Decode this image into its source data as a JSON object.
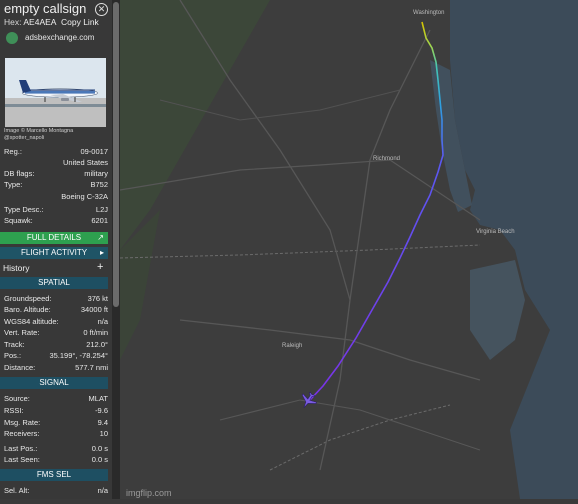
{
  "header": {
    "callsign": "empty callsign",
    "hex_label": "Hex:",
    "hex_value": "AE4AEA",
    "copy_link": "Copy Link",
    "close_icon": "close-icon",
    "site": "adsbexchange.com"
  },
  "photo": {
    "credit_line1": "Image © Marcello Montagna",
    "credit_line2": "@spotter_napoli"
  },
  "details": [
    {
      "k": "Reg.:",
      "v": "09-0017"
    },
    {
      "k": "",
      "v": "United States"
    },
    {
      "k": "DB flags:",
      "v": "military"
    },
    {
      "k": "Type:",
      "v": "B752"
    },
    {
      "k": "",
      "v": "Boeing C-32A"
    },
    {
      "k": "Type Desc.:",
      "v": "L2J"
    },
    {
      "k": "Squawk:",
      "v": "6201"
    }
  ],
  "buttons": {
    "full_details": "FULL DETAILS",
    "flight_activity": "FLIGHT ACTIVITY"
  },
  "history": "History",
  "sections": {
    "spatial": "SPATIAL",
    "signal": "SIGNAL",
    "fms": "FMS SEL"
  },
  "spatial": [
    {
      "k": "Groundspeed:",
      "v": "376 kt"
    },
    {
      "k": "Baro. Altitude:",
      "v": "34000 ft"
    },
    {
      "k": "WGS84 altitude:",
      "v": "n/a"
    },
    {
      "k": "Vert. Rate:",
      "v": "0 ft/min"
    },
    {
      "k": "Track:",
      "v": "212.0°"
    },
    {
      "k": "Pos.:",
      "v": "35.199°, -78.254°"
    },
    {
      "k": "Distance:",
      "v": "577.7 nmi"
    }
  ],
  "signal": [
    {
      "k": "Source:",
      "v": "MLAT"
    },
    {
      "k": "RSSI:",
      "v": "-9.6"
    },
    {
      "k": "Msg. Rate:",
      "v": "9.4"
    },
    {
      "k": "Receivers:",
      "v": "10"
    },
    {
      "k": "Last Pos.:",
      "v": "0.0 s"
    },
    {
      "k": "Last Seen:",
      "v": "0.0 s"
    }
  ],
  "fms_row": {
    "k": "Sel. Alt:",
    "v": "n/a"
  },
  "map": {
    "labels": [
      "Washington",
      "Richmond",
      "Virginia Beach",
      "Raleigh"
    ],
    "watermark": "imgflip.com"
  }
}
